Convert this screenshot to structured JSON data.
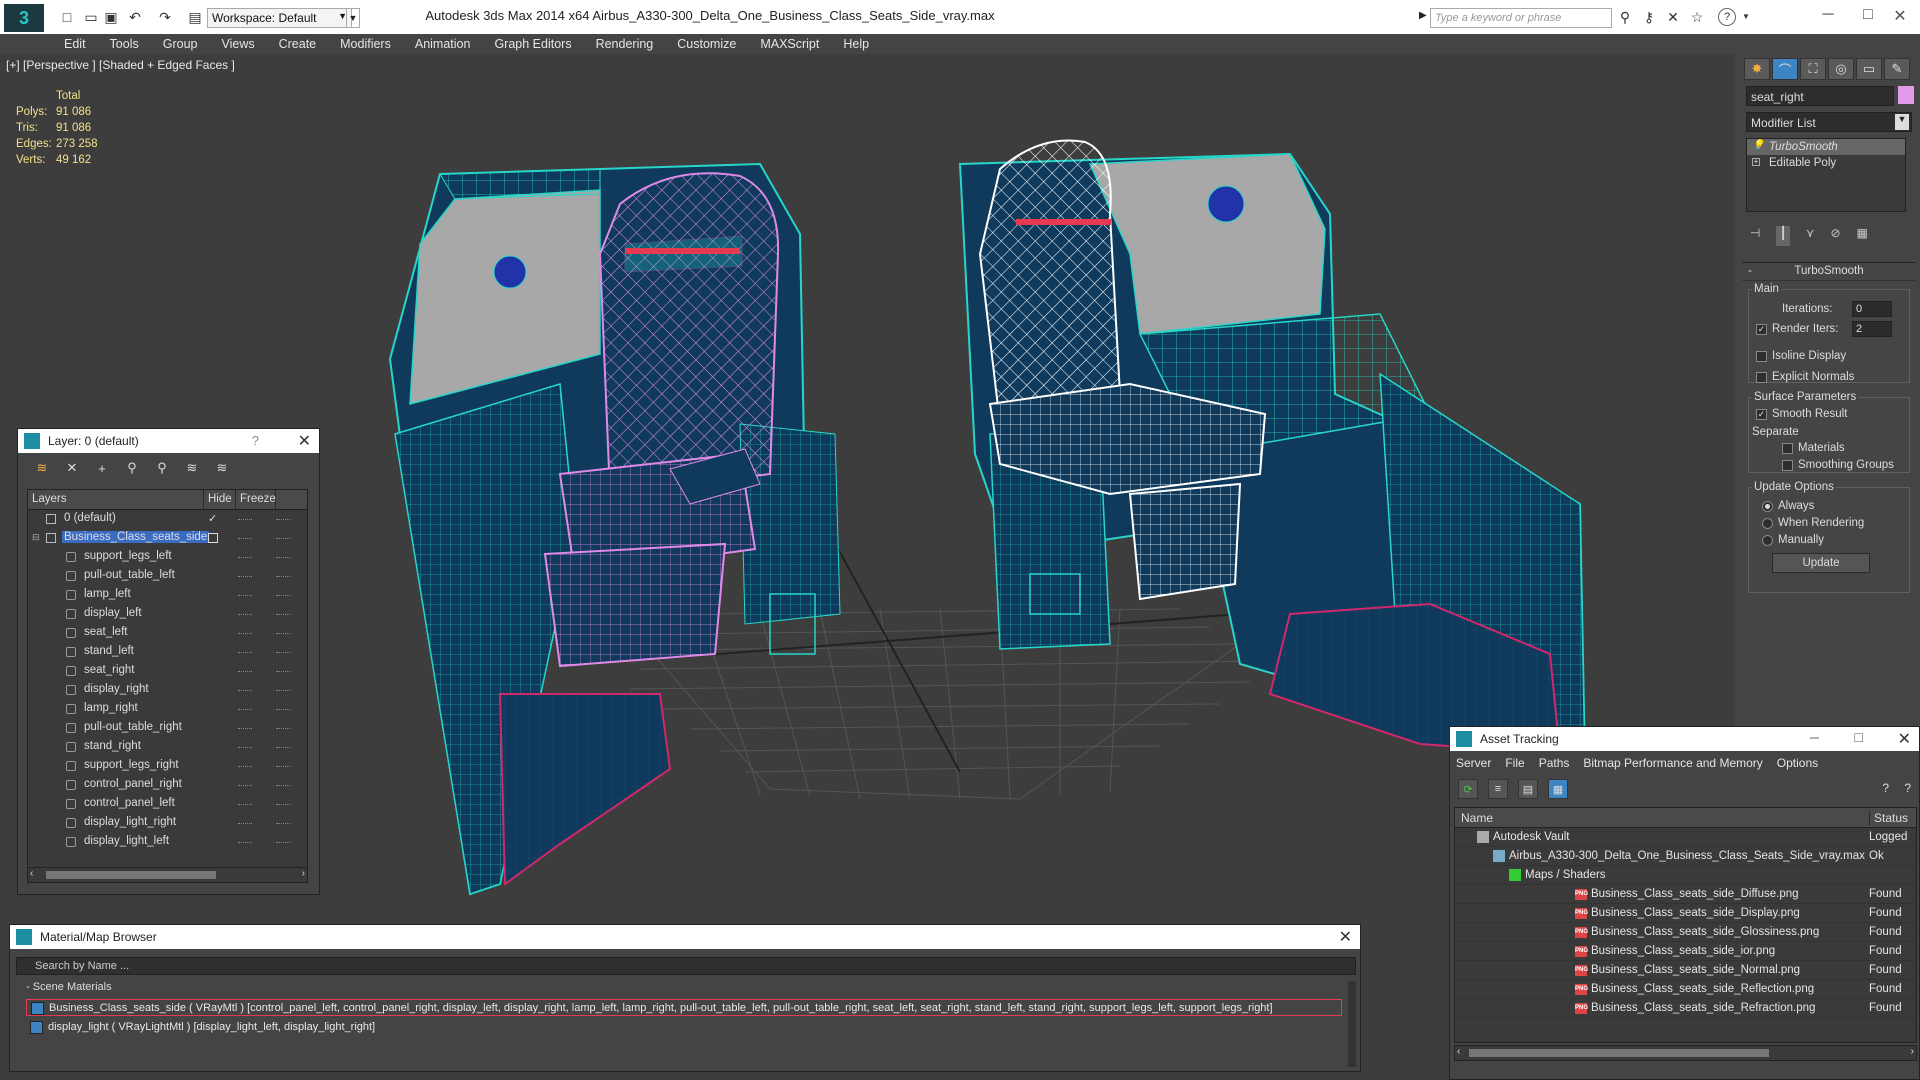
{
  "app": {
    "title": "Autodesk 3ds Max  2014 x64      Airbus_A330-300_Delta_One_Business_Class_Seats_Side_vray.max",
    "workspace": "Workspace: Default",
    "search_placeholder": "Type a keyword or phrase"
  },
  "menu": [
    "Edit",
    "Tools",
    "Group",
    "Views",
    "Create",
    "Modifiers",
    "Animation",
    "Graph Editors",
    "Rendering",
    "Customize",
    "MAXScript",
    "Help"
  ],
  "viewport": {
    "label": "[+] [Perspective ] [Shaded + Edged Faces ]",
    "stats": {
      "header": "Total",
      "rows": [
        {
          "label": "Polys:",
          "value": "91 086"
        },
        {
          "label": "Tris:",
          "value": "91 086"
        },
        {
          "label": "Edges:",
          "value": "273 258"
        },
        {
          "label": "Verts:",
          "value": "49 162"
        }
      ]
    }
  },
  "command_panel": {
    "object_name": "seat_right",
    "object_color": "#e39be9",
    "modifier_list": "Modifier List",
    "stack": [
      "TurboSmooth",
      "Editable Poly"
    ],
    "rollout_title": "TurboSmooth",
    "main_label": "Main",
    "iterations_label": "Iterations:",
    "iterations_value": "0",
    "render_iters_label": "Render Iters:",
    "render_iters_value": "2",
    "isoline_label": "Isoline Display",
    "explicit_normals_label": "Explicit Normals",
    "surface_params_label": "Surface Parameters",
    "smooth_result_label": "Smooth Result",
    "separate_label": "Separate",
    "materials_label": "Materials",
    "smoothing_groups_label": "Smoothing Groups",
    "update_options_label": "Update Options",
    "always_label": "Always",
    "when_rendering_label": "When Rendering",
    "manually_label": "Manually",
    "update_button": "Update"
  },
  "layer_window": {
    "title": "Layer: 0 (default)",
    "help": "?",
    "columns": {
      "layers": "Layers",
      "hide": "Hide",
      "freeze": "Freeze"
    },
    "rows": [
      {
        "name": "0 (default)",
        "level": 0,
        "kind": "layer",
        "active": true
      },
      {
        "name": "Business_Class_seats_side",
        "level": 0,
        "kind": "layer",
        "selected": true
      },
      {
        "name": "support_legs_left",
        "level": 1,
        "kind": "object"
      },
      {
        "name": "pull-out_table_left",
        "level": 1,
        "kind": "object"
      },
      {
        "name": "lamp_left",
        "level": 1,
        "kind": "object"
      },
      {
        "name": "display_left",
        "level": 1,
        "kind": "object"
      },
      {
        "name": "seat_left",
        "level": 1,
        "kind": "object"
      },
      {
        "name": "stand_left",
        "level": 1,
        "kind": "object"
      },
      {
        "name": "seat_right",
        "level": 1,
        "kind": "object"
      },
      {
        "name": "display_right",
        "level": 1,
        "kind": "object"
      },
      {
        "name": "lamp_right",
        "level": 1,
        "kind": "object"
      },
      {
        "name": "pull-out_table_right",
        "level": 1,
        "kind": "object"
      },
      {
        "name": "stand_right",
        "level": 1,
        "kind": "object"
      },
      {
        "name": "support_legs_right",
        "level": 1,
        "kind": "object"
      },
      {
        "name": "control_panel_right",
        "level": 1,
        "kind": "object"
      },
      {
        "name": "control_panel_left",
        "level": 1,
        "kind": "object"
      },
      {
        "name": "display_light_right",
        "level": 1,
        "kind": "object"
      },
      {
        "name": "display_light_left",
        "level": 1,
        "kind": "object"
      }
    ]
  },
  "material_browser": {
    "title": "Material/Map Browser",
    "search_placeholder": "Search by Name ...",
    "group": "- Scene Materials",
    "materials": [
      "Business_Class_seats_side ( VRayMtl ) [control_panel_left, control_panel_right, display_left, display_right, lamp_left, lamp_right, pull-out_table_left, pull-out_table_right, seat_left, seat_right, stand_left, stand_right, support_legs_left, support_legs_right]",
      "display_light ( VRayLightMtl ) [display_light_left, display_light_right]"
    ]
  },
  "asset_tracking": {
    "title": "Asset Tracking",
    "menu": [
      "Server",
      "File",
      "Paths",
      "Bitmap Performance and Memory",
      "Options"
    ],
    "columns": {
      "name": "Name",
      "status": "Status"
    },
    "rows": [
      {
        "name": "Autodesk Vault",
        "status": "Logged",
        "level": 0,
        "icon": "vault"
      },
      {
        "name": "Airbus_A330-300_Delta_One_Business_Class_Seats_Side_vray.max",
        "status": "Ok",
        "level": 1,
        "icon": "max"
      },
      {
        "name": "Maps / Shaders",
        "status": "",
        "level": 2,
        "icon": "maps"
      },
      {
        "name": "Business_Class_seats_side_Diffuse.png",
        "status": "Found",
        "level": 3,
        "icon": "png"
      },
      {
        "name": "Business_Class_seats_side_Display.png",
        "status": "Found",
        "level": 3,
        "icon": "png"
      },
      {
        "name": "Business_Class_seats_side_Glossiness.png",
        "status": "Found",
        "level": 3,
        "icon": "png"
      },
      {
        "name": "Business_Class_seats_side_ior.png",
        "status": "Found",
        "level": 3,
        "icon": "png"
      },
      {
        "name": "Business_Class_seats_side_Normal.png",
        "status": "Found",
        "level": 3,
        "icon": "png"
      },
      {
        "name": "Business_Class_seats_side_Reflection.png",
        "status": "Found",
        "level": 3,
        "icon": "png"
      },
      {
        "name": "Business_Class_seats_side_Refraction.png",
        "status": "Found",
        "level": 3,
        "icon": "png"
      }
    ]
  },
  "colors": {
    "wire_teal": "#27d6c8",
    "wire_pink": "#e08ae8",
    "wire_white": "#ffffff",
    "wire_magenta": "#d0286a",
    "surface_blue": "#0f3a5c",
    "stats_yellow": "#f2e08b",
    "selection_blue": "#3b6cc4"
  }
}
